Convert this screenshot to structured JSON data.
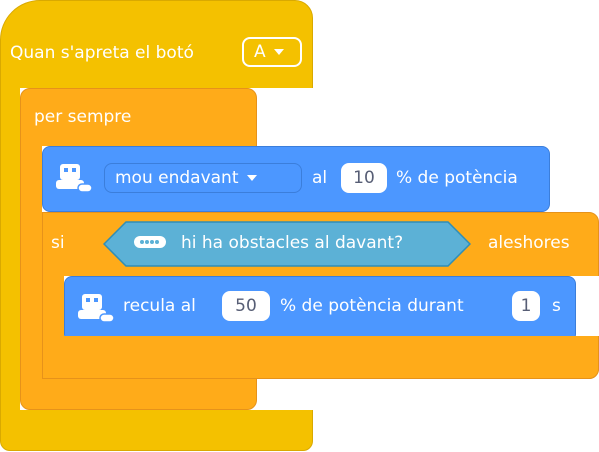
{
  "hat": {
    "label": "Quan s'apreta el botó",
    "button_value": "A"
  },
  "forever": {
    "label": "per sempre"
  },
  "move": {
    "direction": "mou endavant",
    "at_label": "al",
    "power_value": "10",
    "power_suffix": "% de potència"
  },
  "if_block": {
    "if_label": "si",
    "condition_label": "hi ha obstacles al davant?",
    "then_label": "aleshores"
  },
  "reverse": {
    "label": "recula al",
    "power_value": "50",
    "power_suffix": "% de potència durant",
    "time_value": "1",
    "time_unit": "s"
  },
  "colors": {
    "event_yellow": "#F4C100",
    "control_orange": "#FFAB19",
    "motion_blue": "#4C97FF",
    "sensing_cyan": "#5CB1D6"
  }
}
